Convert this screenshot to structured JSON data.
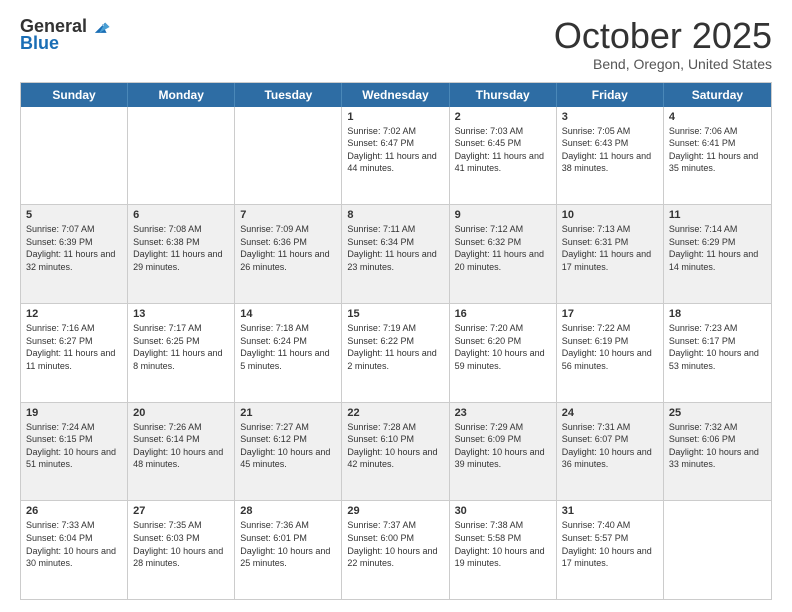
{
  "header": {
    "logo_line1": "General",
    "logo_line2": "Blue",
    "month": "October 2025",
    "location": "Bend, Oregon, United States"
  },
  "days_of_week": [
    "Sunday",
    "Monday",
    "Tuesday",
    "Wednesday",
    "Thursday",
    "Friday",
    "Saturday"
  ],
  "rows": [
    [
      {
        "day": "",
        "info": ""
      },
      {
        "day": "",
        "info": ""
      },
      {
        "day": "",
        "info": ""
      },
      {
        "day": "1",
        "info": "Sunrise: 7:02 AM\nSunset: 6:47 PM\nDaylight: 11 hours and 44 minutes."
      },
      {
        "day": "2",
        "info": "Sunrise: 7:03 AM\nSunset: 6:45 PM\nDaylight: 11 hours and 41 minutes."
      },
      {
        "day": "3",
        "info": "Sunrise: 7:05 AM\nSunset: 6:43 PM\nDaylight: 11 hours and 38 minutes."
      },
      {
        "day": "4",
        "info": "Sunrise: 7:06 AM\nSunset: 6:41 PM\nDaylight: 11 hours and 35 minutes."
      }
    ],
    [
      {
        "day": "5",
        "info": "Sunrise: 7:07 AM\nSunset: 6:39 PM\nDaylight: 11 hours and 32 minutes."
      },
      {
        "day": "6",
        "info": "Sunrise: 7:08 AM\nSunset: 6:38 PM\nDaylight: 11 hours and 29 minutes."
      },
      {
        "day": "7",
        "info": "Sunrise: 7:09 AM\nSunset: 6:36 PM\nDaylight: 11 hours and 26 minutes."
      },
      {
        "day": "8",
        "info": "Sunrise: 7:11 AM\nSunset: 6:34 PM\nDaylight: 11 hours and 23 minutes."
      },
      {
        "day": "9",
        "info": "Sunrise: 7:12 AM\nSunset: 6:32 PM\nDaylight: 11 hours and 20 minutes."
      },
      {
        "day": "10",
        "info": "Sunrise: 7:13 AM\nSunset: 6:31 PM\nDaylight: 11 hours and 17 minutes."
      },
      {
        "day": "11",
        "info": "Sunrise: 7:14 AM\nSunset: 6:29 PM\nDaylight: 11 hours and 14 minutes."
      }
    ],
    [
      {
        "day": "12",
        "info": "Sunrise: 7:16 AM\nSunset: 6:27 PM\nDaylight: 11 hours and 11 minutes."
      },
      {
        "day": "13",
        "info": "Sunrise: 7:17 AM\nSunset: 6:25 PM\nDaylight: 11 hours and 8 minutes."
      },
      {
        "day": "14",
        "info": "Sunrise: 7:18 AM\nSunset: 6:24 PM\nDaylight: 11 hours and 5 minutes."
      },
      {
        "day": "15",
        "info": "Sunrise: 7:19 AM\nSunset: 6:22 PM\nDaylight: 11 hours and 2 minutes."
      },
      {
        "day": "16",
        "info": "Sunrise: 7:20 AM\nSunset: 6:20 PM\nDaylight: 10 hours and 59 minutes."
      },
      {
        "day": "17",
        "info": "Sunrise: 7:22 AM\nSunset: 6:19 PM\nDaylight: 10 hours and 56 minutes."
      },
      {
        "day": "18",
        "info": "Sunrise: 7:23 AM\nSunset: 6:17 PM\nDaylight: 10 hours and 53 minutes."
      }
    ],
    [
      {
        "day": "19",
        "info": "Sunrise: 7:24 AM\nSunset: 6:15 PM\nDaylight: 10 hours and 51 minutes."
      },
      {
        "day": "20",
        "info": "Sunrise: 7:26 AM\nSunset: 6:14 PM\nDaylight: 10 hours and 48 minutes."
      },
      {
        "day": "21",
        "info": "Sunrise: 7:27 AM\nSunset: 6:12 PM\nDaylight: 10 hours and 45 minutes."
      },
      {
        "day": "22",
        "info": "Sunrise: 7:28 AM\nSunset: 6:10 PM\nDaylight: 10 hours and 42 minutes."
      },
      {
        "day": "23",
        "info": "Sunrise: 7:29 AM\nSunset: 6:09 PM\nDaylight: 10 hours and 39 minutes."
      },
      {
        "day": "24",
        "info": "Sunrise: 7:31 AM\nSunset: 6:07 PM\nDaylight: 10 hours and 36 minutes."
      },
      {
        "day": "25",
        "info": "Sunrise: 7:32 AM\nSunset: 6:06 PM\nDaylight: 10 hours and 33 minutes."
      }
    ],
    [
      {
        "day": "26",
        "info": "Sunrise: 7:33 AM\nSunset: 6:04 PM\nDaylight: 10 hours and 30 minutes."
      },
      {
        "day": "27",
        "info": "Sunrise: 7:35 AM\nSunset: 6:03 PM\nDaylight: 10 hours and 28 minutes."
      },
      {
        "day": "28",
        "info": "Sunrise: 7:36 AM\nSunset: 6:01 PM\nDaylight: 10 hours and 25 minutes."
      },
      {
        "day": "29",
        "info": "Sunrise: 7:37 AM\nSunset: 6:00 PM\nDaylight: 10 hours and 22 minutes."
      },
      {
        "day": "30",
        "info": "Sunrise: 7:38 AM\nSunset: 5:58 PM\nDaylight: 10 hours and 19 minutes."
      },
      {
        "day": "31",
        "info": "Sunrise: 7:40 AM\nSunset: 5:57 PM\nDaylight: 10 hours and 17 minutes."
      },
      {
        "day": "",
        "info": ""
      }
    ]
  ]
}
